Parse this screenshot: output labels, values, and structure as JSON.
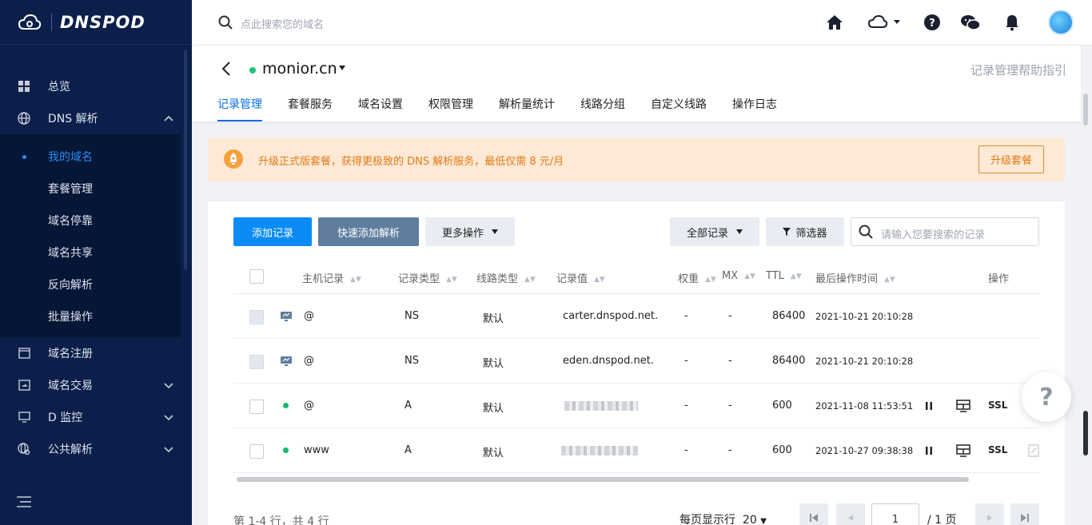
{
  "brand": {
    "name": "DNSPOD"
  },
  "sidebar": {
    "items": [
      {
        "label": "总览",
        "icon": "grid-icon"
      },
      {
        "label": "DNS 解析",
        "icon": "globe-icon",
        "expanded": true
      }
    ],
    "sub_items": [
      {
        "label": "我的域名",
        "active": true
      },
      {
        "label": "套餐管理"
      },
      {
        "label": "域名停靠"
      },
      {
        "label": "域名共享"
      },
      {
        "label": "反向解析"
      },
      {
        "label": "批量操作"
      }
    ],
    "items_after": [
      {
        "label": "域名注册",
        "icon": "window-icon"
      },
      {
        "label": "域名交易",
        "icon": "trade-icon"
      },
      {
        "label": "D 监控",
        "icon": "monitor-icon"
      },
      {
        "label": "公共解析",
        "icon": "globe-gear-icon"
      }
    ]
  },
  "topbar": {
    "search_placeholder": "点此搜索您的域名"
  },
  "domain": {
    "name": "monior.cn",
    "help_link": "记录管理帮助指引",
    "tabs": [
      "记录管理",
      "套餐服务",
      "域名设置",
      "权限管理",
      "解析量统计",
      "线路分组",
      "自定义线路",
      "操作日志"
    ],
    "active_tab": 0
  },
  "banner": {
    "text": "升级正式版套餐，获得更极致的 DNS 解析服务，最低仅需 8 元/月",
    "button": "升级套餐",
    "accent": "#e07a15"
  },
  "toolbar": {
    "add_record": "添加记录",
    "quick_add": "快速添加解析",
    "more_ops": "更多操作",
    "all_records": "全部记录",
    "filter": "筛选器",
    "search_placeholder": "请输入您要搜索的记录"
  },
  "table": {
    "headers": {
      "host": "主机记录",
      "type": "记录类型",
      "line": "线路类型",
      "value": "记录值",
      "weight": "权重",
      "mx": "MX",
      "ttl": "TTL",
      "time": "最后操作时间",
      "ops": "操作"
    },
    "rows": [
      {
        "host": "@",
        "type": "NS",
        "line": "默认",
        "value": "carter.dnspod.net.",
        "weight": "-",
        "mx": "-",
        "ttl": "86400",
        "time": "2021-10-21 20:10:28",
        "status": "system"
      },
      {
        "host": "@",
        "type": "NS",
        "line": "默认",
        "value": "eden.dnspod.net.",
        "weight": "-",
        "mx": "-",
        "ttl": "86400",
        "time": "2021-10-21 20:10:28",
        "status": "system"
      },
      {
        "host": "@",
        "type": "A",
        "line": "默认",
        "value": "",
        "weight": "-",
        "mx": "-",
        "ttl": "600",
        "time": "2021-11-08 11:53:51",
        "status": "enabled",
        "ssl": "SSL"
      },
      {
        "host": "www",
        "type": "A",
        "line": "默认",
        "value": "",
        "weight": "-",
        "mx": "-",
        "ttl": "600",
        "time": "2021-10-27 09:38:38",
        "status": "enabled",
        "ssl": "SSL"
      }
    ]
  },
  "footer": {
    "count_text": "第 1-4 行，共 4 行",
    "per_page_label": "每页显示行",
    "per_page_value": "20",
    "page_current": "1",
    "page_total": "/ 1 页"
  },
  "help_float": "?"
}
